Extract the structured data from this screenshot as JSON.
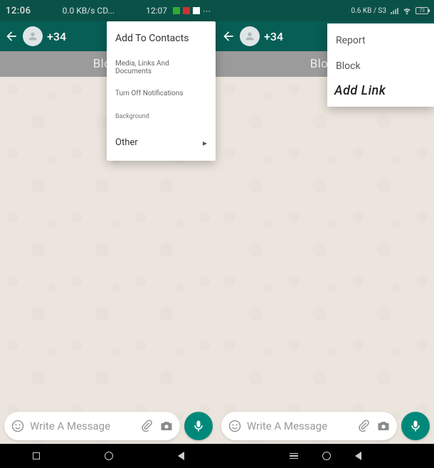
{
  "left": {
    "status": {
      "time": "12:06",
      "net": "0.0 KB/s CD..."
    },
    "toolbar": {
      "number": "+34"
    },
    "banner": {
      "block": "Block"
    },
    "menu": {
      "add_to_contacts": "Add To Contacts",
      "media": "Media, Links And Documents",
      "turn_off": "Turn Off Notifications",
      "background": "Background",
      "other": "Other"
    },
    "input": {
      "placeholder": "Write A Message"
    },
    "status2": {
      "time": "12:07"
    }
  },
  "right": {
    "status": {
      "net": "0.6 KB / S3",
      "battery": "73"
    },
    "toolbar": {
      "number": "+34"
    },
    "banner": {
      "block": "Block"
    },
    "menu": {
      "report": "Report",
      "block": "Block",
      "add_link": "Add Link"
    },
    "input": {
      "placeholder": "Write A Message"
    }
  }
}
